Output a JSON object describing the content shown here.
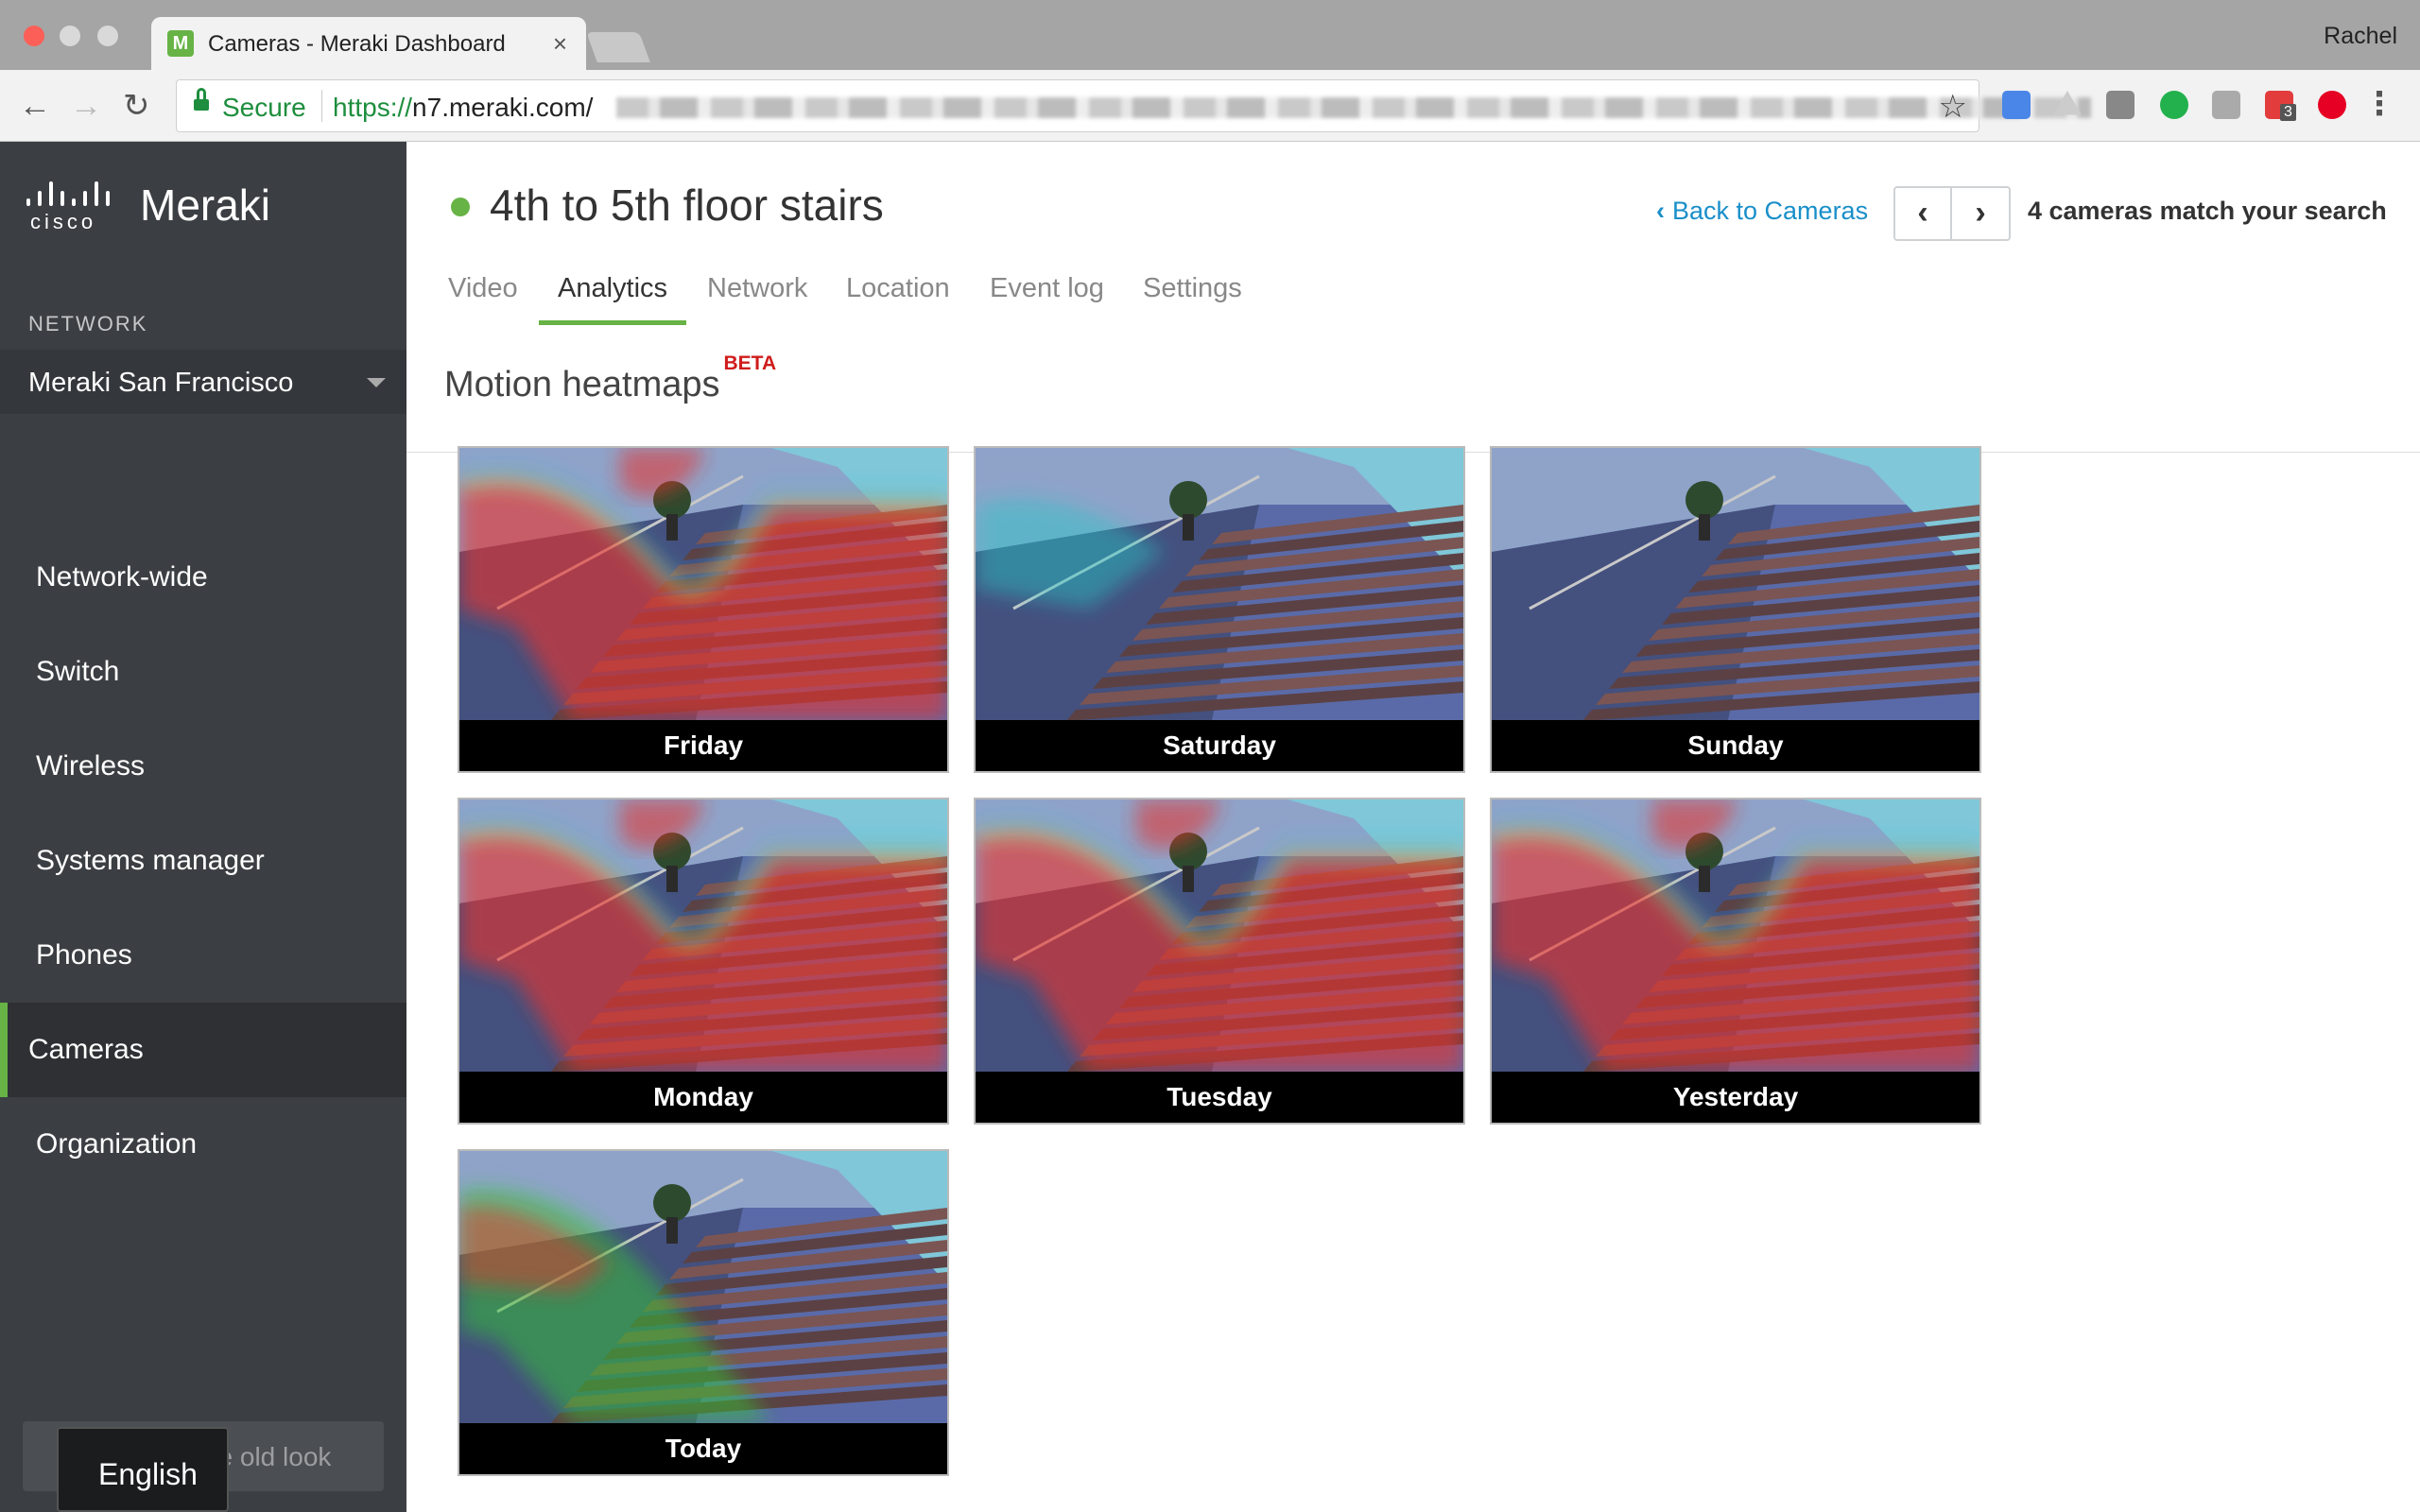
{
  "browser": {
    "tab_title": "Cameras - Meraki Dashboard",
    "favicon_letter": "M",
    "tab_close_glyph": "×",
    "profile_name": "Rachel",
    "secure_label": "Secure",
    "url_scheme": "https://",
    "url_host": "n7.meraki.com/",
    "back_glyph": "←",
    "forward_glyph": "→",
    "reload_glyph": "↻",
    "star_glyph": "☆",
    "menu_glyph": "⋮",
    "extension_badge": "3"
  },
  "sidebar": {
    "brand_logo_text": "cisco",
    "brand_name": "Meraki",
    "network_label": "NETWORK",
    "network_value": "Meraki San Francisco",
    "nav": [
      {
        "label": "Network-wide",
        "active": false
      },
      {
        "label": "Switch",
        "active": false
      },
      {
        "label": "Wireless",
        "active": false
      },
      {
        "label": "Systems manager",
        "active": false
      },
      {
        "label": "Phones",
        "active": false
      },
      {
        "label": "Cameras",
        "active": true
      },
      {
        "label": "Organization",
        "active": false
      }
    ],
    "old_look_label": "Go back to the old look",
    "language_label": "English",
    "accent_color": "#67b346"
  },
  "header": {
    "camera_name": "4th to 5th floor stairs",
    "status_color": "#67b346",
    "back_label": "Back to Cameras",
    "back_chevron": "‹",
    "prev_glyph": "‹",
    "next_glyph": "›",
    "match_text": "4 cameras match your search"
  },
  "tabs": [
    {
      "label": "Video",
      "active": false
    },
    {
      "label": "Analytics",
      "active": true
    },
    {
      "label": "Network",
      "active": false
    },
    {
      "label": "Location",
      "active": false
    },
    {
      "label": "Event log",
      "active": false
    },
    {
      "label": "Settings",
      "active": false
    }
  ],
  "section": {
    "title": "Motion heatmaps",
    "badge": "BETA"
  },
  "heatmaps": [
    {
      "day": "Friday",
      "intensity": "high"
    },
    {
      "day": "Saturday",
      "intensity": "low"
    },
    {
      "day": "Sunday",
      "intensity": "none"
    },
    {
      "day": "Monday",
      "intensity": "high"
    },
    {
      "day": "Tuesday",
      "intensity": "high"
    },
    {
      "day": "Yesterday",
      "intensity": "high"
    },
    {
      "day": "Today",
      "intensity": "medium"
    }
  ]
}
